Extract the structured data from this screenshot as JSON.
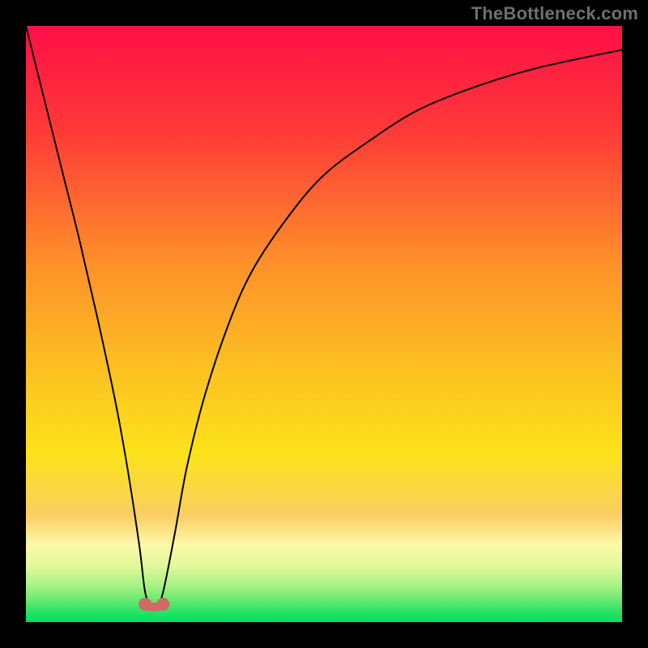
{
  "watermark": "TheBottleneck.com",
  "chart_data": {
    "type": "line",
    "title": "",
    "xlabel": "",
    "ylabel": "",
    "xlim": [
      0,
      100
    ],
    "ylim": [
      0,
      100
    ],
    "series": [
      {
        "name": "bottleneck-curve",
        "x": [
          0,
          3,
          6,
          9,
          12,
          15,
          17,
          19,
          20,
          21,
          22,
          23,
          25,
          27,
          30,
          34,
          38,
          44,
          50,
          58,
          66,
          76,
          86,
          100
        ],
        "values": [
          100,
          88,
          76,
          64,
          51,
          37,
          26,
          13,
          5,
          3,
          3,
          5,
          15,
          26,
          38,
          50,
          59,
          68,
          75,
          81,
          86,
          90,
          93,
          96
        ]
      }
    ],
    "markers": [
      {
        "x": 20,
        "y": 3
      },
      {
        "x": 23,
        "y": 3
      }
    ],
    "gradient_stops": [
      {
        "pos": 0.0,
        "color": "#ff0f46"
      },
      {
        "pos": 0.18,
        "color": "#ff3b37"
      },
      {
        "pos": 0.4,
        "color": "#fe912a"
      },
      {
        "pos": 0.58,
        "color": "#fcc221"
      },
      {
        "pos": 0.72,
        "color": "#fbe31a"
      },
      {
        "pos": 0.82,
        "color": "#face62"
      },
      {
        "pos": 0.87,
        "color": "#fcf8a8"
      },
      {
        "pos": 0.905,
        "color": "#e2f89b"
      },
      {
        "pos": 0.935,
        "color": "#aef388"
      },
      {
        "pos": 0.96,
        "color": "#71eb74"
      },
      {
        "pos": 0.985,
        "color": "#22e264"
      },
      {
        "pos": 1.0,
        "color": "#05df5e"
      }
    ]
  }
}
